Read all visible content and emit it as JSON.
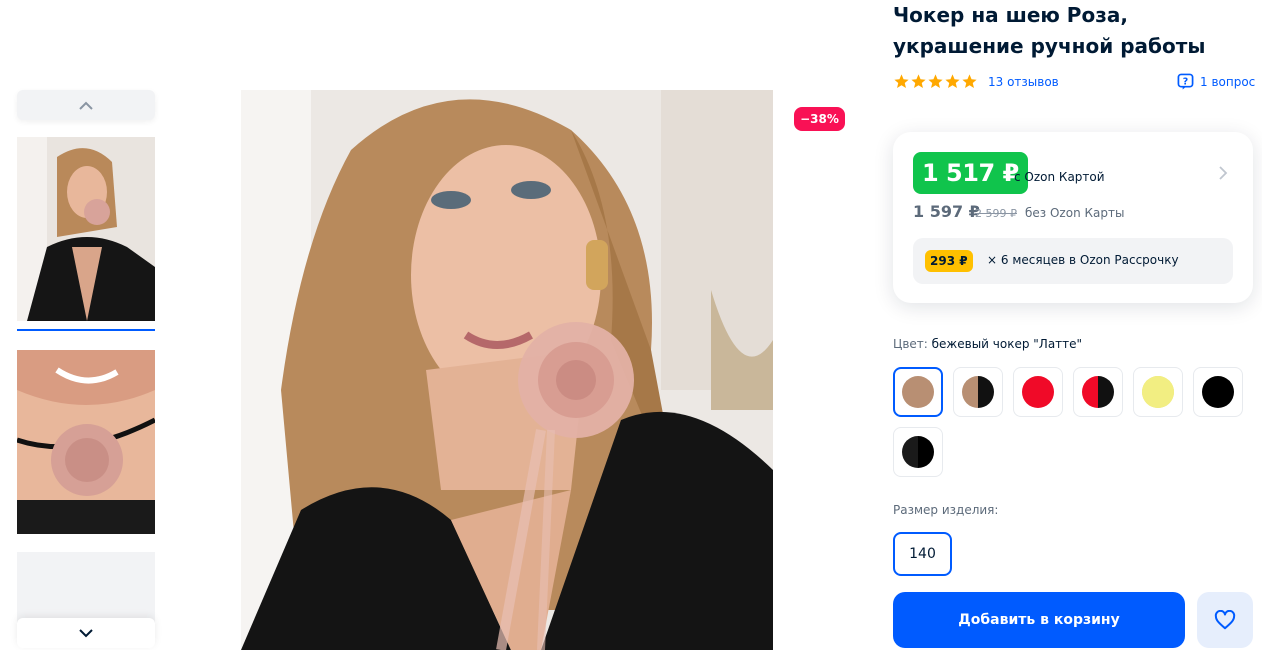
{
  "product": {
    "title": "Чокер на шею Роза, украшение ручной работы",
    "reviews": "13 отзывов",
    "questions": "1 вопрос",
    "discount": "−38%",
    "rating": 5
  },
  "price": {
    "ozon_card_price": "1 517 ₽",
    "ozon_card_note": "с Ozon Картой",
    "regular_price": "1 597 ₽",
    "old_price": "2 599 ₽",
    "regular_note": "без Ozon Карты",
    "installment_amount": "293 ₽",
    "installment_text": "× 6 месяцев в Ozon Рассрочку"
  },
  "color": {
    "label": "Цвет:",
    "selected": "бежевый чокер \"Латте\"",
    "swatches": [
      {
        "name": "latte",
        "colors": [
          "#b88f73"
        ]
      },
      {
        "name": "latte-black",
        "colors": [
          "#b88f73",
          "#111111"
        ]
      },
      {
        "name": "red",
        "colors": [
          "#f00a28"
        ]
      },
      {
        "name": "red-black",
        "colors": [
          "#f00a28",
          "#111111"
        ]
      },
      {
        "name": "yellow",
        "colors": [
          "#f2ee82"
        ]
      },
      {
        "name": "black",
        "colors": [
          "#000000"
        ]
      },
      {
        "name": "black-dark",
        "colors": [
          "#1a1a1a",
          "#000000"
        ]
      }
    ]
  },
  "size": {
    "label": "Размер изделия:",
    "value": "140"
  },
  "actions": {
    "add_to_cart": "Добавить в корзину"
  },
  "colors": {
    "accent": "#005bff",
    "ozon_price": "#10c44c",
    "discount": "#f91155",
    "installment": "#ffc000"
  }
}
